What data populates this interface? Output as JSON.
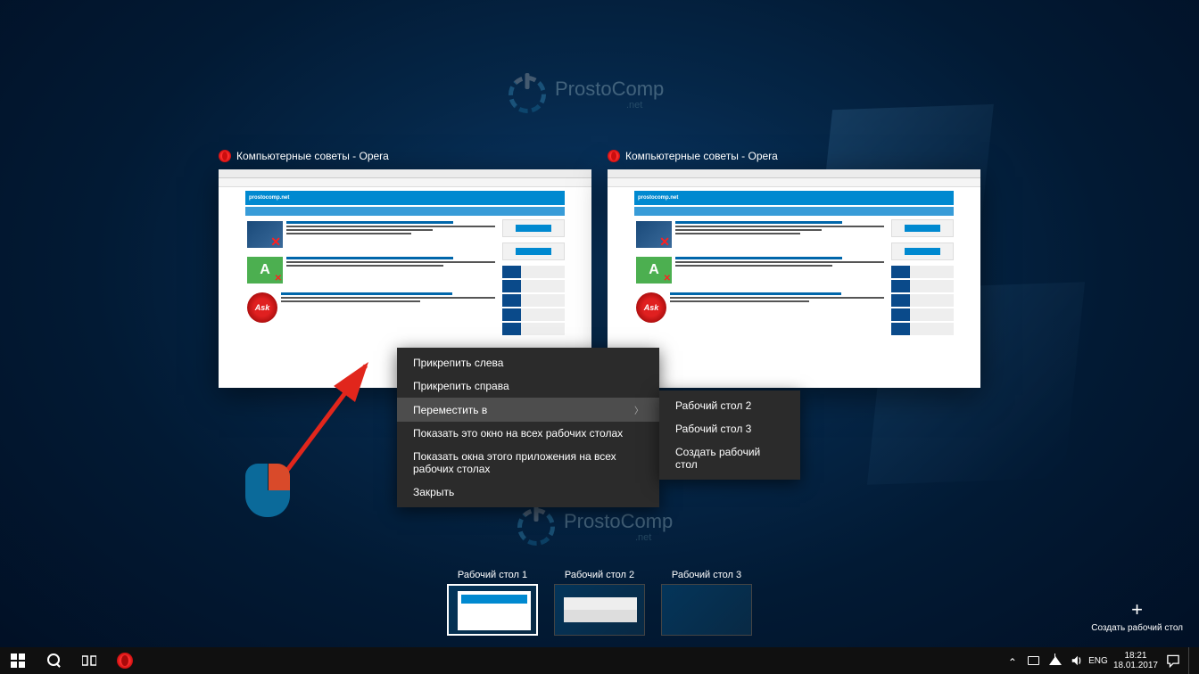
{
  "watermark": {
    "brand": "ProstoComp",
    "suffix": ".net"
  },
  "task_windows": [
    {
      "title": "Компьютерные советы - Opera",
      "site_title": "prostocomp.net"
    },
    {
      "title": "Компьютерные советы - Opera",
      "site_title": "prostocomp.net"
    }
  ],
  "context_menu": {
    "items": [
      {
        "label": "Прикрепить слева",
        "submenu": false,
        "highlighted": false
      },
      {
        "label": "Прикрепить справа",
        "submenu": false,
        "highlighted": false
      },
      {
        "label": "Переместить в",
        "submenu": true,
        "highlighted": true
      },
      {
        "label": "Показать это окно на всех рабочих столах",
        "submenu": false,
        "highlighted": false
      },
      {
        "label": "Показать окна этого приложения на всех рабочих столах",
        "submenu": false,
        "highlighted": false
      },
      {
        "label": "Закрыть",
        "submenu": false,
        "highlighted": false
      }
    ],
    "submenu": [
      {
        "label": "Рабочий стол 2"
      },
      {
        "label": "Рабочий стол 3"
      },
      {
        "label": "Создать рабочий стол"
      }
    ]
  },
  "desktops": [
    {
      "label": "Рабочий стол 1",
      "active": true
    },
    {
      "label": "Рабочий стол 2",
      "active": false
    },
    {
      "label": "Рабочий стол 3",
      "active": false
    }
  ],
  "new_desktop_label": "Создать рабочий стол",
  "systray": {
    "lang": "ENG",
    "time": "18:21",
    "date": "18.01.2017"
  },
  "annotation_colors": {
    "arrow": "#e1261c"
  }
}
